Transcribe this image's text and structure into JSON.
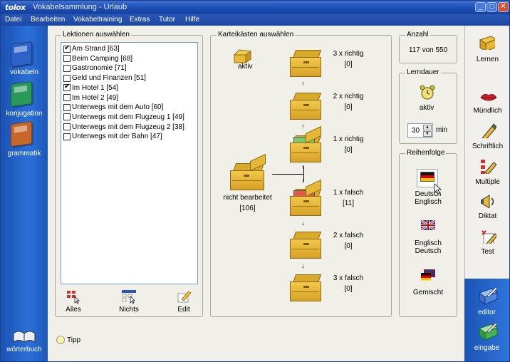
{
  "window": {
    "logo": "tolox",
    "title": "Vokabelsammlung - Urlaub"
  },
  "menu": [
    "Datei",
    "Bearbeiten",
    "Vokabeltraining",
    "Extras",
    "Tutor",
    "Hilfe"
  ],
  "left_sidebar": {
    "items": [
      {
        "label": "vokabeln",
        "color": "#2f62c9"
      },
      {
        "label": "konjugation",
        "color": "#2a9a5a"
      },
      {
        "label": "grammatik",
        "color": "#c8672b"
      }
    ],
    "bottom": {
      "label": "wörterbuch"
    }
  },
  "lessons_panel": {
    "title": "Lektionen auswählen",
    "items": [
      {
        "label": "Am Strand [63]",
        "checked": true
      },
      {
        "label": "Beim Camping [68]",
        "checked": false
      },
      {
        "label": "Gastronomie [71]",
        "checked": false
      },
      {
        "label": "Geld und Finanzen [51]",
        "checked": false
      },
      {
        "label": "Im Hotel 1 [54]",
        "checked": true
      },
      {
        "label": "Im Hotel 2 [49]",
        "checked": false
      },
      {
        "label": "Unterwegs mit dem Auto [60]",
        "checked": false
      },
      {
        "label": "Unterwegs mit dem Flugzeug 1 [49]",
        "checked": false
      },
      {
        "label": "Unterwegs mit dem Flugzeug 2 [38]",
        "checked": false
      },
      {
        "label": "Unterwegs mit der Bahn [47]",
        "checked": false
      }
    ],
    "buttons": {
      "all": "Alles",
      "none": "Nichts",
      "edit": "Edit"
    }
  },
  "boxes_panel": {
    "title": "Karteikästen auswählen",
    "active_label": "aktiv",
    "unprocessed": {
      "label": "nicht bearbeitet",
      "count": "[106]"
    },
    "boxes": [
      {
        "label": "3 x richtig",
        "count": "[0]"
      },
      {
        "label": "2 x richtig",
        "count": "[0]"
      },
      {
        "label": "1 x richtig",
        "count": "[0]"
      },
      {
        "label": "1 x falsch",
        "count": "[11]"
      },
      {
        "label": "2 x falsch",
        "count": "[0]"
      },
      {
        "label": "3 x falsch",
        "count": "[0]"
      }
    ]
  },
  "anzahl": {
    "title": "Anzahl",
    "value": "117 von 550"
  },
  "lerndauer": {
    "title": "Lerndauer",
    "status": "aktiv",
    "value": "30",
    "unit": "min"
  },
  "reihenfolge": {
    "title": "Reihenfolge",
    "options": [
      {
        "line1": "Deutsch",
        "line2": "Englisch"
      },
      {
        "line1": "Englisch",
        "line2": "Deutsch"
      },
      {
        "line1": "Gemischt",
        "line2": ""
      }
    ]
  },
  "tipp": "Tipp",
  "right_sidebar": {
    "items": [
      "Lernen",
      "Mündlich",
      "Schriftlich",
      "Multiple",
      "Diktat",
      "Test"
    ],
    "bottom": [
      "editor",
      "eingabe"
    ]
  }
}
